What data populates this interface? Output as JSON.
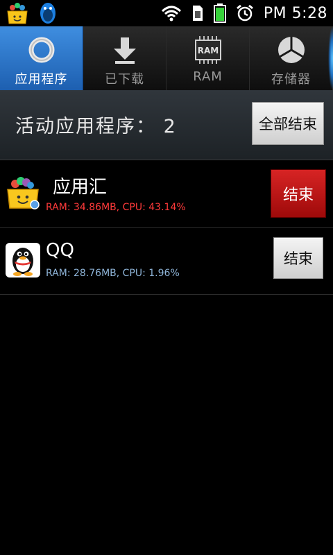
{
  "status_bar": {
    "time": "PM 5:28",
    "icons": [
      "app-store-icon",
      "qq-penguin-icon",
      "wifi-icon",
      "sim-icon",
      "battery-icon",
      "alarm-icon"
    ],
    "battery_color": "#36d13a"
  },
  "tabs": [
    {
      "label": "应用程序",
      "icon": "circle-ring-icon",
      "active": true
    },
    {
      "label": "已下载",
      "icon": "download-arrow-icon",
      "active": false
    },
    {
      "label": "RAM",
      "icon": "ram-chip-icon",
      "chip_text": "RAM",
      "active": false
    },
    {
      "label": "存储器",
      "icon": "pie-storage-icon",
      "active": false
    }
  ],
  "summary": {
    "title": "活动应用程序： 2",
    "end_all_label": "全部结束"
  },
  "apps": [
    {
      "name": "应用汇",
      "stats": "RAM: 34.86MB, CPU: 43.14%",
      "end_label": "结束",
      "stats_color": "#ff3a3a",
      "button_style": "red",
      "icon": "app-store-bag-icon"
    },
    {
      "name": "QQ",
      "stats": "RAM: 28.76MB, CPU: 1.96%",
      "end_label": "结束",
      "stats_color": "#8fb5d9",
      "button_style": "grey",
      "icon": "qq-penguin-icon"
    }
  ],
  "colors": {
    "accent_tab": "#2f7ad0",
    "end_red": "#c41515"
  }
}
